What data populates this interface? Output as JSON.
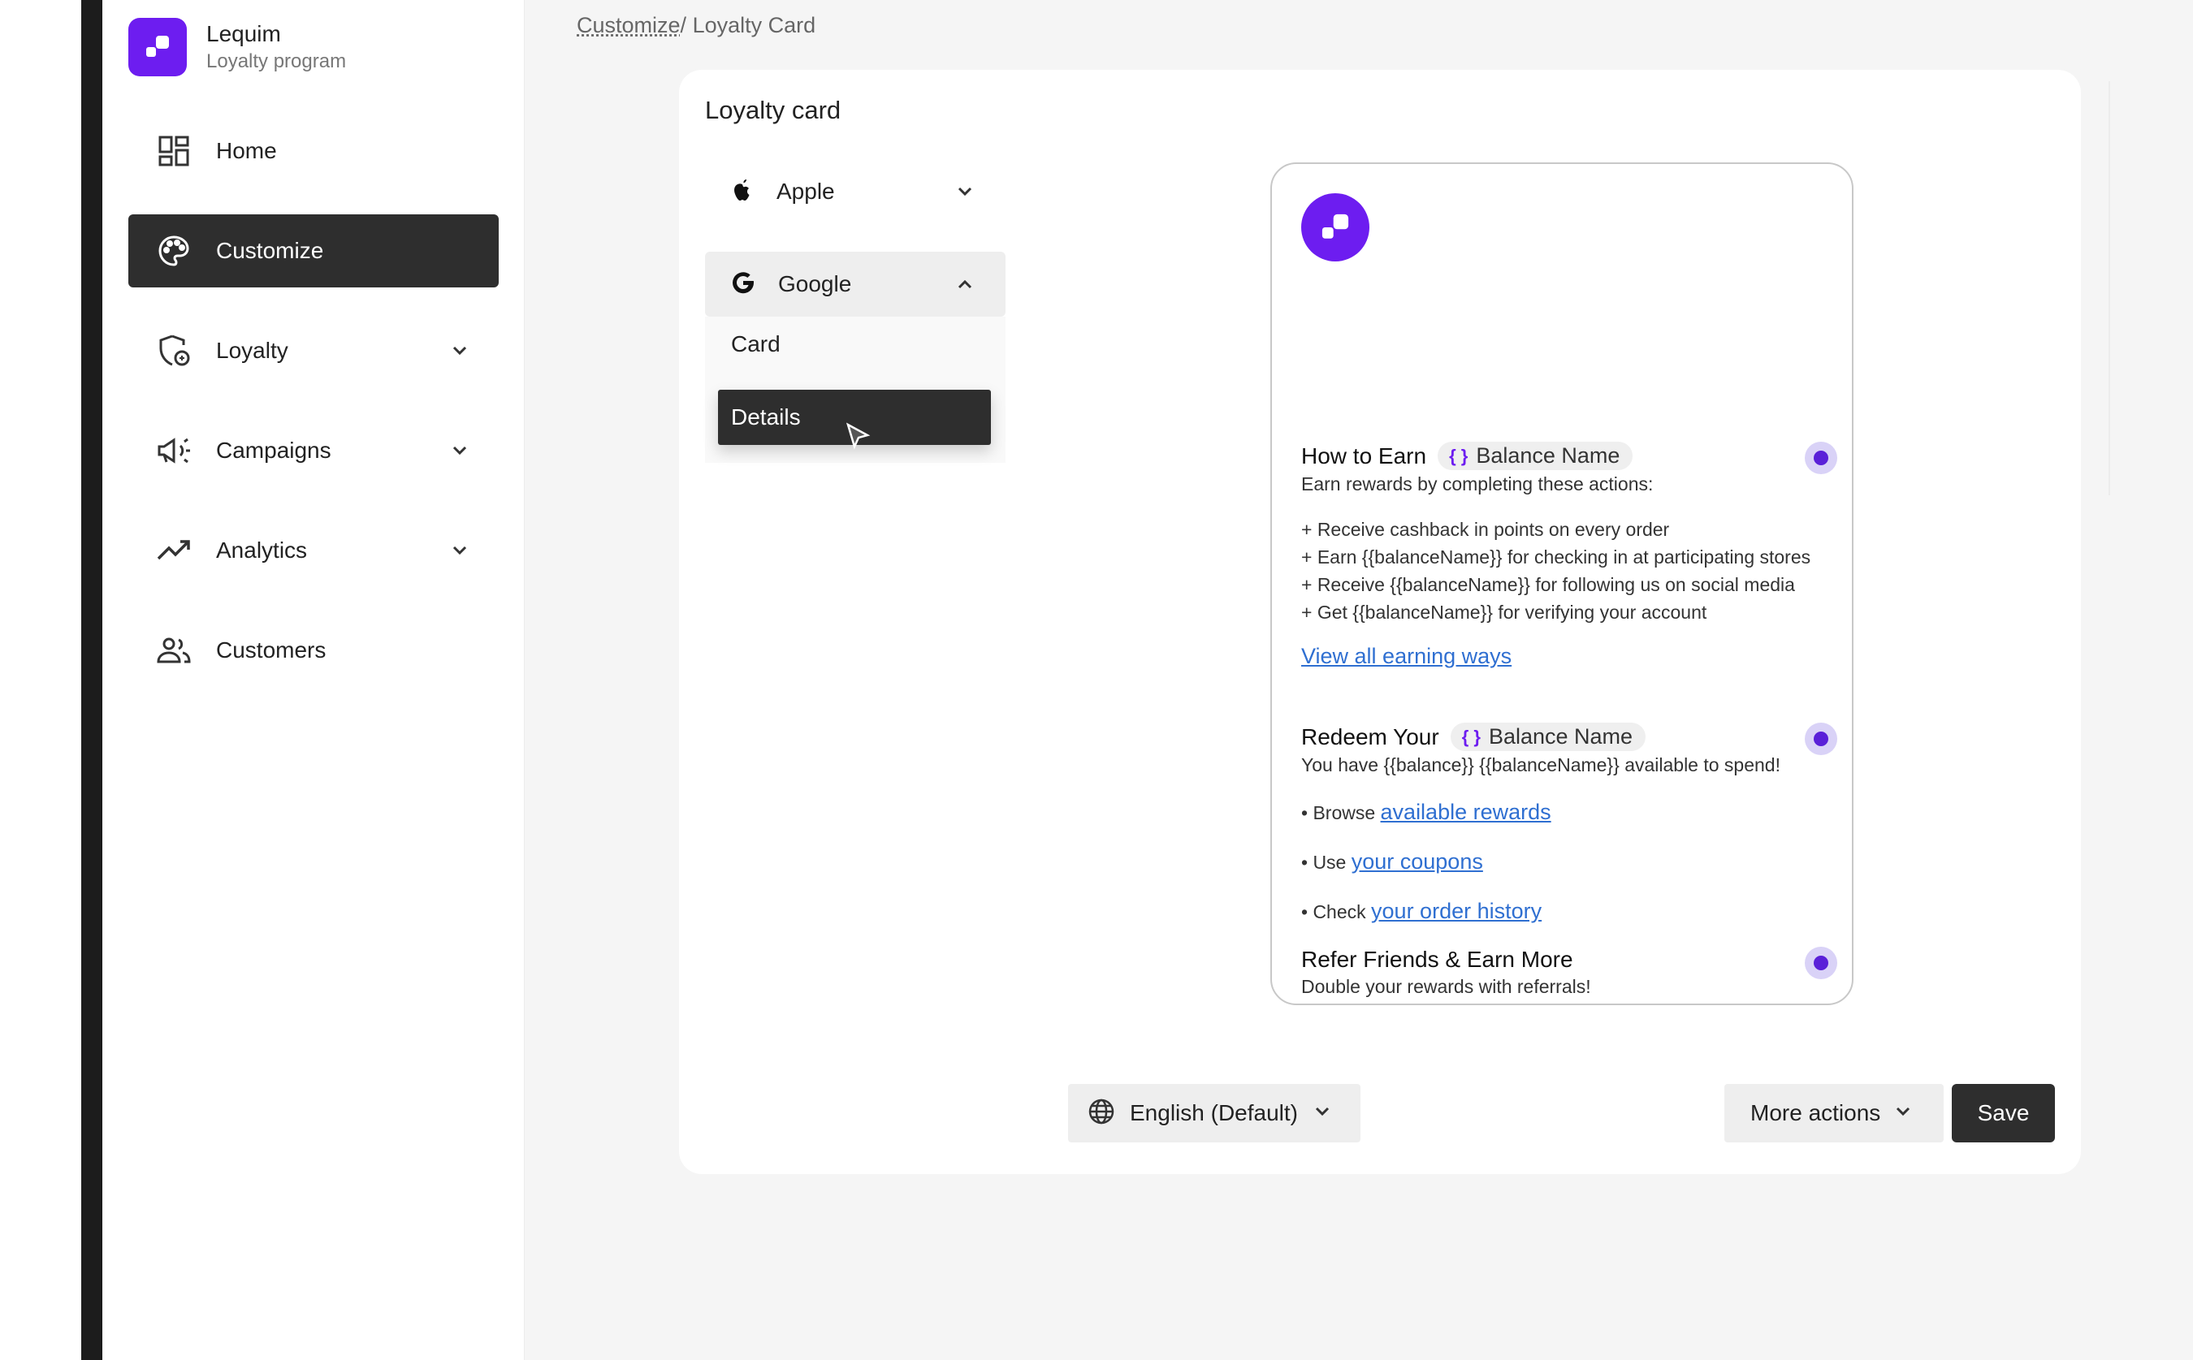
{
  "brand": {
    "name": "Lequim",
    "subtitle": "Loyalty program",
    "accent": "#6d1df0"
  },
  "nav": {
    "items": [
      {
        "label": "Home",
        "icon": "dashboard-icon"
      },
      {
        "label": "Customize",
        "icon": "palette-icon",
        "active": true
      },
      {
        "label": "Loyalty",
        "icon": "shield-icon"
      },
      {
        "label": "Campaigns",
        "icon": "megaphone-icon"
      },
      {
        "label": "Analytics",
        "icon": "trending-up-icon"
      },
      {
        "label": "Customers",
        "icon": "people-icon"
      }
    ]
  },
  "breadcrumb": {
    "parent": "Customize",
    "separator": "/",
    "current": "Loyalty Card"
  },
  "panel": {
    "title": "Loyalty card",
    "platforms": {
      "apple": "Apple",
      "google": "Google",
      "google_items": {
        "card": "Card",
        "details": "Details"
      }
    }
  },
  "preview": {
    "earn": {
      "title": "How to Earn",
      "chip": "Balance Name",
      "subtitle": "Earn rewards by completing these actions:",
      "lines": [
        "+ Receive cashback in points on every order",
        "+ Earn {{balanceName}} for checking in at participating stores",
        "+ Receive {{balanceName}} for following us on social media",
        "+ Get {{balanceName}} for verifying your account"
      ],
      "link": "View all earning ways"
    },
    "redeem": {
      "title": "Redeem Your",
      "chip": "Balance Name",
      "subtitle": "You have {{balance}} {{balanceName}} available to spend!",
      "browse_prefix": "• Browse",
      "browse_link": "available rewards",
      "use_prefix": "• Use",
      "use_link": "your coupons",
      "check_prefix": "• Check",
      "check_link": "your order history"
    },
    "refer": {
      "title": "Refer Friends & Earn More",
      "subtitle": "Double your rewards with referrals!"
    }
  },
  "footer": {
    "language": "English (Default)",
    "more_actions": "More actions",
    "save": "Save"
  }
}
